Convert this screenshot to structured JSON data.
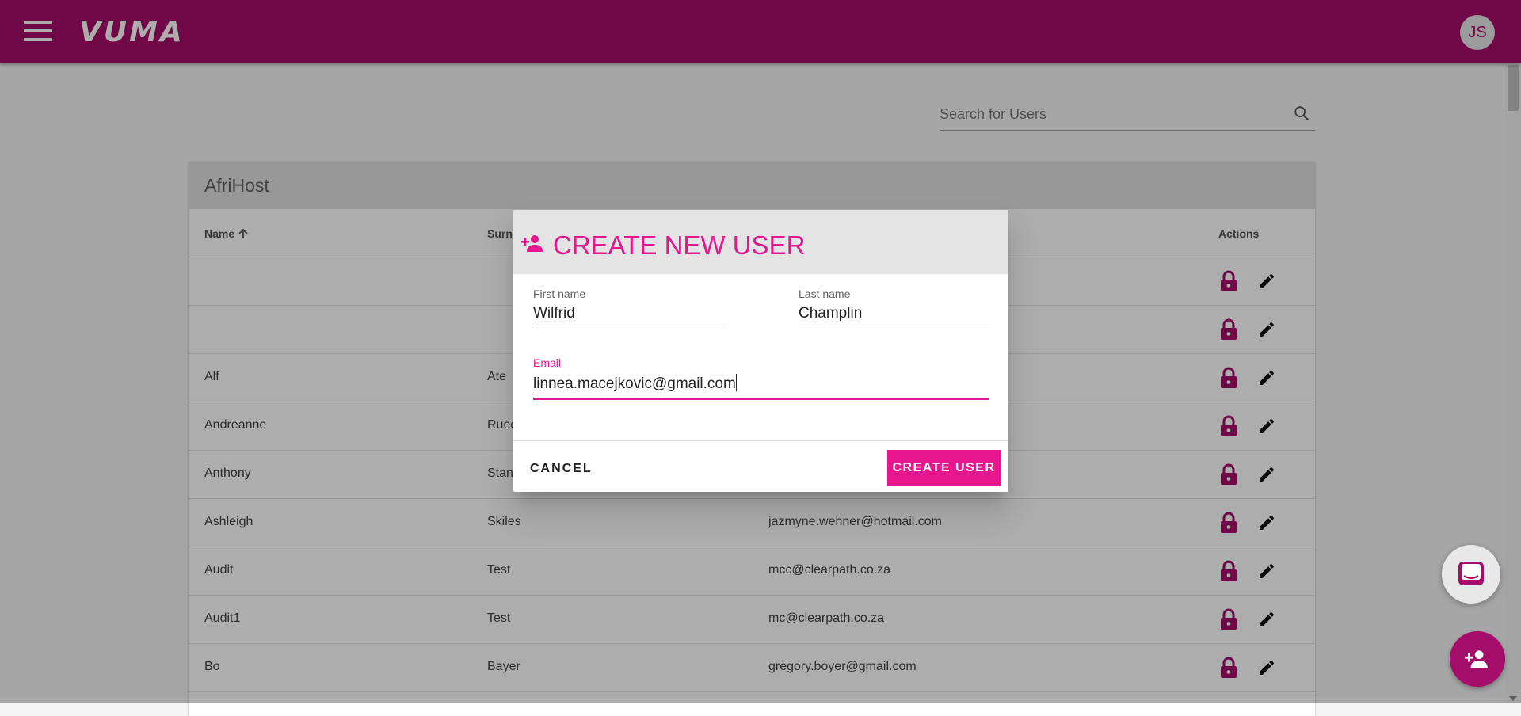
{
  "app": {
    "logo": "VUMA",
    "avatar_initials": "JS"
  },
  "search": {
    "placeholder": "Search for Users"
  },
  "card": {
    "title": "AfriHost",
    "columns": {
      "name": "Name",
      "surname": "Surna",
      "actions": "Actions"
    },
    "rows": [
      {
        "name": "",
        "surname": "",
        "email": ""
      },
      {
        "name": "",
        "surname": "",
        "email": ""
      },
      {
        "name": "Alf",
        "surname": "Ate",
        "email": ""
      },
      {
        "name": "Andreanne",
        "surname": "Ruec",
        "email": ""
      },
      {
        "name": "Anthony",
        "surname": "Stan",
        "email": ""
      },
      {
        "name": "Ashleigh",
        "surname": "Skiles",
        "email": "jazmyne.wehner@hotmail.com"
      },
      {
        "name": "Audit",
        "surname": "Test",
        "email": "mcc@clearpath.co.za"
      },
      {
        "name": "Audit1",
        "surname": "Test",
        "email": "mc@clearpath.co.za"
      },
      {
        "name": "Bo",
        "surname": "Bayer",
        "email": "gregory.boyer@gmail.com"
      }
    ]
  },
  "dialog": {
    "title": "CREATE NEW USER",
    "first_name": {
      "label": "First name",
      "value": "Wilfrid"
    },
    "last_name": {
      "label": "Last name",
      "value": "Champlin"
    },
    "email": {
      "label": "Email",
      "value": "linnea.macejkovic@gmail.com"
    },
    "cancel_label": "CANCEL",
    "create_label": "CREATE USER"
  },
  "colors": {
    "brand": "#a50d6a",
    "accent": "#e6178e"
  },
  "icons": [
    "menu-icon",
    "search-icon",
    "lock-icon",
    "edit-icon",
    "person-add-icon",
    "chat-icon",
    "sort-arrow-up-icon"
  ]
}
